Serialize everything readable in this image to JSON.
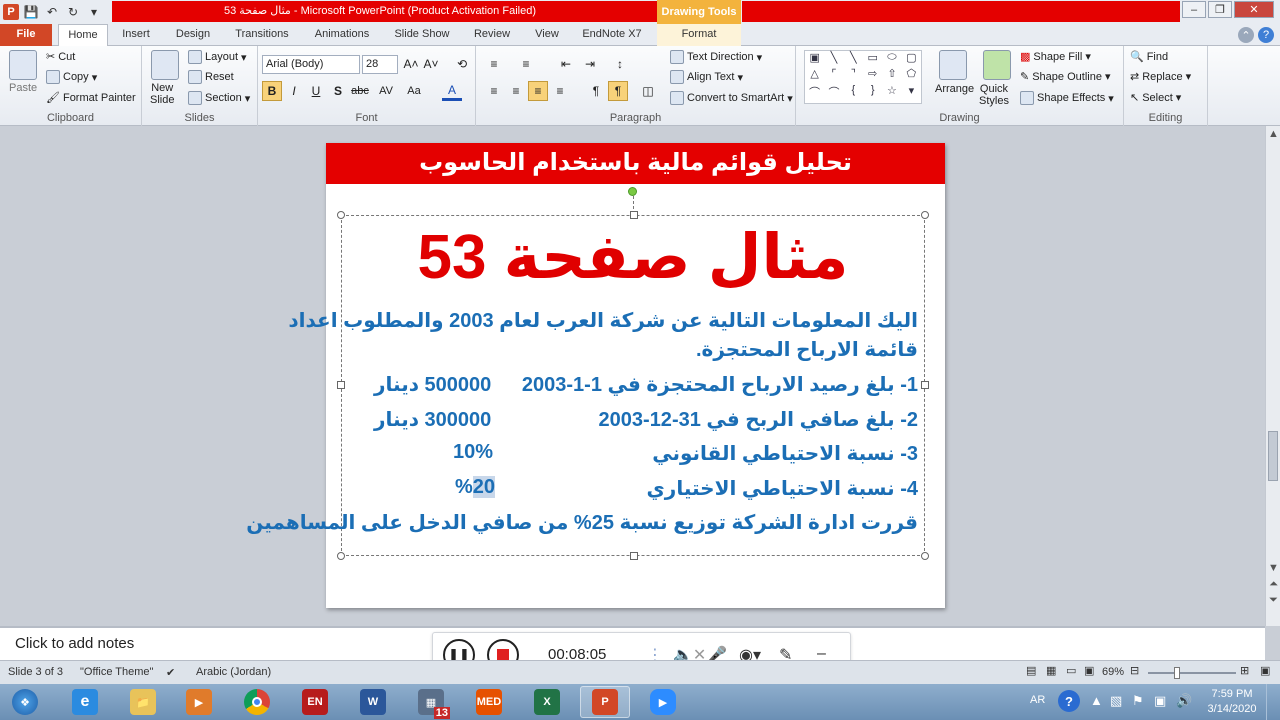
{
  "window": {
    "title": "مثال صفحة 53 - Microsoft PowerPoint (Product Activation Failed)",
    "contextual_tab_group": "Drawing Tools"
  },
  "tabs": [
    "File",
    "Home",
    "Insert",
    "Design",
    "Transitions",
    "Animations",
    "Slide Show",
    "Review",
    "View",
    "EndNote X7",
    "Format"
  ],
  "ribbon": {
    "clipboard": {
      "paste": "Paste",
      "cut": "Cut",
      "copy": "Copy",
      "format_painter": "Format Painter",
      "label": "Clipboard"
    },
    "slides": {
      "new_slide_line1": "New",
      "new_slide_line2": "Slide",
      "layout": "Layout",
      "reset": "Reset",
      "section": "Section",
      "label": "Slides"
    },
    "font": {
      "font_name": "Arial (Body)",
      "font_size": "28",
      "label": "Font"
    },
    "paragraph": {
      "text_direction": "Text Direction",
      "align_text": "Align Text",
      "convert_smartart": "Convert to SmartArt",
      "label": "Paragraph"
    },
    "drawing": {
      "arrange": "Arrange",
      "quick_styles_line1": "Quick",
      "quick_styles_line2": "Styles",
      "shape_fill": "Shape Fill",
      "shape_outline": "Shape Outline",
      "shape_effects": "Shape Effects",
      "label": "Drawing"
    },
    "editing": {
      "find": "Find",
      "replace": "Replace",
      "select": "Select",
      "label": "Editing"
    }
  },
  "slide": {
    "banner": "تحليل قوائم مالية باستخدام الحاسوب",
    "title": "مثال صفحة 53",
    "intro_line1": "اليك المعلومات التالية عن شركة العرب لعام 2003 والمطلوب اعداد",
    "intro_line2": "قائمة الارباح المحتجزة.",
    "items": [
      {
        "text": "1- بلغ رصيد الارباح المحتجزة في 1-1-2003",
        "value": "500000 دينار"
      },
      {
        "text": "2- بلغ صافي الربح في 31-12-2003",
        "value": "300000 دينار"
      },
      {
        "text": "3- نسبة الاحتياطي القانوني",
        "value": "10%"
      },
      {
        "text": "4- نسبة الاحتياطي الاختياري",
        "value_number": "20",
        "value_suffix": "%"
      }
    ],
    "footer_line": "قررت ادارة الشركة توزيع نسبة 25% من صافي الدخل على المساهمين"
  },
  "notes_placeholder": "Click to add notes",
  "recorder": {
    "elapsed": "00:08:05"
  },
  "statusbar": {
    "slide_info": "Slide 3 of 3",
    "theme": "\"Office Theme\"",
    "language": "Arabic (Jordan)",
    "zoom": "69%"
  },
  "taskbar": {
    "apps": [
      "start",
      "internet-explorer",
      "file-explorer",
      "media-player",
      "chrome",
      "endnote",
      "word",
      "calculator",
      "med",
      "excel",
      "powerpoint",
      "zoom"
    ],
    "calculator_badge": "13",
    "med_label": "MED",
    "lang": "AR",
    "time": "7:59 PM",
    "date": "3/14/2020"
  },
  "colors": {
    "accent_red": "#e40000",
    "file_tab": "#d24726",
    "body_text": "#1b6eb5",
    "title_text": "#e00000"
  }
}
